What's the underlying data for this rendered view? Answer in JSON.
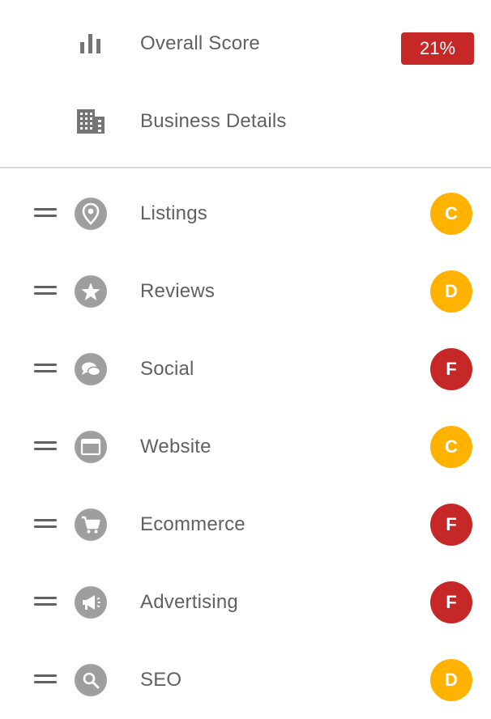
{
  "summary": {
    "overall_score_label": "Overall Score",
    "overall_score_value": "21%",
    "business_details_label": "Business Details"
  },
  "colors": {
    "grade_c": "#ffb300",
    "grade_d": "#ffb300",
    "grade_f": "#c62828",
    "score_badge": "#c62828",
    "icon_gray": "#9e9e9e"
  },
  "categories": [
    {
      "label": "Listings",
      "grade": "C",
      "icon": "map-pin-icon"
    },
    {
      "label": "Reviews",
      "grade": "D",
      "icon": "star-icon"
    },
    {
      "label": "Social",
      "grade": "F",
      "icon": "chat-bubble-icon"
    },
    {
      "label": "Website",
      "grade": "C",
      "icon": "browser-window-icon"
    },
    {
      "label": "Ecommerce",
      "grade": "F",
      "icon": "shopping-cart-icon"
    },
    {
      "label": "Advertising",
      "grade": "F",
      "icon": "megaphone-icon"
    },
    {
      "label": "SEO",
      "grade": "D",
      "icon": "magnifier-icon"
    }
  ]
}
